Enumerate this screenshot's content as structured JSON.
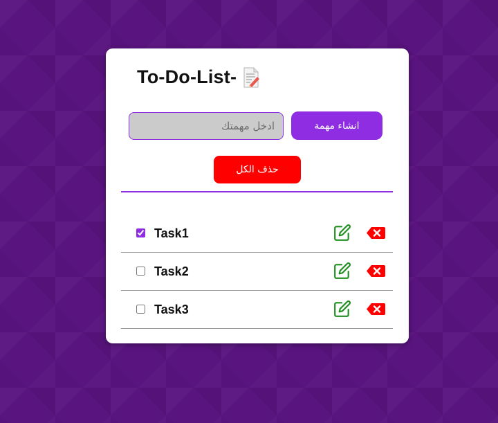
{
  "app": {
    "title": "To-Do-List-",
    "title_icon": "memo-icon"
  },
  "form": {
    "input_placeholder": "ادخل مهمتك",
    "input_value": "",
    "create_label": "انشاء مهمة",
    "delete_all_label": "حذف الكل"
  },
  "tasks": [
    {
      "name": "Task1",
      "checked": true
    },
    {
      "name": "Task2",
      "checked": false
    },
    {
      "name": "Task3",
      "checked": false
    }
  ],
  "colors": {
    "background": "#5a1480",
    "accent": "#8e2de2",
    "delete": "#ff0000",
    "edit": "#1e8e1e",
    "card": "#ffffff"
  }
}
